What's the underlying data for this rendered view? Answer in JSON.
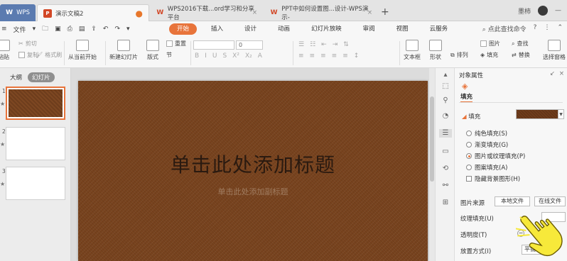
{
  "tabs": {
    "wps": "WPS",
    "active": "演示文稿2",
    "tab2": "WPS2016下载...ord学习和分享平台",
    "tab3": "PPT中如何设置图...设计-WPS演示-"
  },
  "topbar": {
    "user": "墨柿"
  },
  "menu": {
    "file": "文件",
    "tabs": [
      "开始",
      "插入",
      "设计",
      "动画",
      "幻灯片放映",
      "审阅",
      "视图",
      "云服务"
    ],
    "search": "点此查找命令"
  },
  "ribbon": {
    "paste": "粘贴",
    "cut": "剪切",
    "copy": "复制",
    "format_painter": "格式刷",
    "from_current": "从当前开始",
    "new_slide": "新建幻灯片",
    "layout": "版式",
    "section": "节",
    "reset": "重置",
    "font_size": "0",
    "textbox": "文本框",
    "shape": "形状",
    "arrange": "排列",
    "picture": "图片",
    "fill": "填充",
    "find": "查找",
    "replace": "替换",
    "select_pane": "选择窗格"
  },
  "left_panel": {
    "outline_tab": "大纲",
    "slides_tab": "幻灯片",
    "slide_numbers": [
      "1",
      "2",
      "3"
    ]
  },
  "slide": {
    "title": "单击此处添加标题",
    "subtitle": "单击此处添加副标题"
  },
  "property_pane": {
    "header": "对象属性",
    "fill_tab": "填充",
    "fill_section": "填充",
    "options": [
      "纯色填充(S)",
      "渐变填充(G)",
      "图片或纹理填充(P)",
      "图案填充(A)"
    ],
    "hide_bg": "隐藏背景图形(H)",
    "pic_source": "图片来源",
    "local_file": "本地文件",
    "online_file": "在线文件",
    "texture_fill": "纹理填充(U)",
    "transparency": "透明度(T)",
    "placement": "放置方式(I)",
    "placement_value": "平铺"
  }
}
